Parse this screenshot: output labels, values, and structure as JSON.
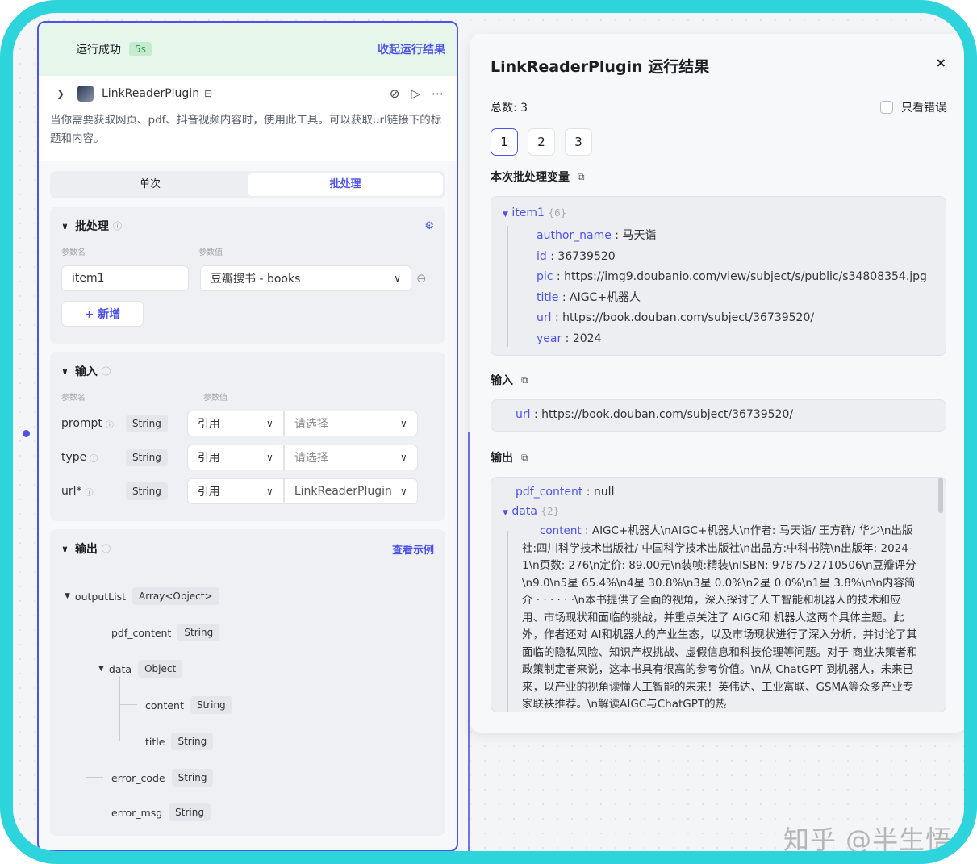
{
  "node": {
    "run_status": "运行成功",
    "run_time": "5s",
    "collapse_label": "收起运行结果",
    "plugin_name": "LinkReaderPlugin",
    "description": "当你需要获取网页、pdf、抖音视频内容时，使用此工具。可以获取url链接下的标题和内容。",
    "tabs": [
      "单次",
      "批处理"
    ],
    "batch": {
      "title": "批处理",
      "col_name": "参数名",
      "col_value": "参数值",
      "item_name": "item1",
      "item_value": "豆瓣搜书 - books",
      "add_label": "+ 新增"
    },
    "input": {
      "title": "输入",
      "col_name": "参数名",
      "col_value": "参数值",
      "params": [
        {
          "name": "prompt",
          "type": "String",
          "mode": "引用",
          "value": "请选择"
        },
        {
          "name": "type",
          "type": "String",
          "mode": "引用",
          "value": "请选择"
        },
        {
          "name": "url*",
          "type": "String",
          "mode": "引用",
          "value": "LinkReaderPlugin"
        }
      ]
    },
    "output": {
      "title": "输出",
      "example_label": "查看示例",
      "tree": {
        "root": {
          "name": "outputList",
          "type": "Array<Object>"
        },
        "pdf_content": {
          "name": "pdf_content",
          "type": "String"
        },
        "data": {
          "name": "data",
          "type": "Object"
        },
        "content": {
          "name": "content",
          "type": "String"
        },
        "title": {
          "name": "title",
          "type": "String"
        },
        "error_code": {
          "name": "error_code",
          "type": "String"
        },
        "error_msg": {
          "name": "error_msg",
          "type": "String"
        }
      }
    }
  },
  "result": {
    "title": "LinkReaderPlugin 运行结果",
    "close_icon": "close-icon",
    "total_label": "总数: 3",
    "errors_only_label": "只看错误",
    "pages": [
      "1",
      "2",
      "3"
    ],
    "batch_vars_label": "本次批处理变量",
    "item": {
      "header": "item1",
      "count": "{6}",
      "rows": [
        {
          "k": "author_name",
          "v": "马天诣"
        },
        {
          "k": "id",
          "v": "36739520"
        },
        {
          "k": "pic",
          "v": "https://img9.doubanio.com/view/subject/s/public/s34808354.jpg"
        },
        {
          "k": "title",
          "v": "AIGC+机器人"
        },
        {
          "k": "url",
          "v": "https://book.douban.com/subject/36739520/"
        },
        {
          "k": "year",
          "v": "2024"
        }
      ]
    },
    "input_label": "输入",
    "input_row": {
      "k": "url",
      "v": "https://book.douban.com/subject/36739520/"
    },
    "output_label": "输出",
    "output": {
      "pdf_content_k": "pdf_content",
      "pdf_content_v": "null",
      "data_k": "data",
      "data_count": "{2}",
      "content_k": "content",
      "content_v": "AIGC+机器人\\nAIGC+机器人\\n作者: 马天诣/ 王方群/ 华少\\n出版社:四川科学技术出版社/ 中国科学技术出版社\\n出品方:中科书院\\n出版年: 2024-1\\n页数: 276\\n定价: 89.00元\\n装帧:精装\\nISBN: 9787572710506\\n豆瓣评分\\n9.0\\n5星 65.4%\\n4星 30.8%\\n3星 0.0%\\n2星 0.0%\\n1星 3.8%\\n\\n内容简介 · · · · · ·\\n本书提供了全面的视角，深入探讨了人工智能和机器人的技术和应用、市场现状和面临的挑战，并重点关注了 AIGC和 机器人这两个具体主题。此外，作者还对 AI和机器人的产业生态，以及市场现状进行了深入分析，并讨论了其面临的隐私风险、知识产权挑战、虚假信息和科技伦理等问题。对于 商业决策者和政策制定者来说，这本书具有很高的参考价值。\\n从 ChatGPT 到机器人，未来已来，以产业的视角读懂人工智能的未来！英伟达、工业富联、GSMA等众多产业专家联袂推荐。\\n解读AIGC与ChatGPT的热"
    }
  },
  "watermark": "知乎 @半生悟"
}
